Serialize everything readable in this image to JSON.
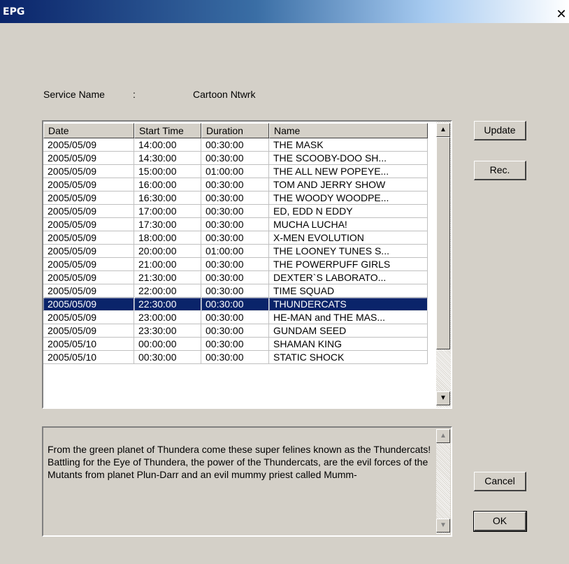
{
  "window": {
    "title": "EPG",
    "close_glyph": "✕"
  },
  "service": {
    "label": "Service Name",
    "sep": ":",
    "value": "Cartoon Ntwrk"
  },
  "table": {
    "columns": [
      "Date",
      "Start Time",
      "Duration",
      "Name"
    ],
    "rows": [
      [
        "2005/05/09",
        "14:00:00",
        "00:30:00",
        "THE MASK"
      ],
      [
        "2005/05/09",
        "14:30:00",
        "00:30:00",
        "THE SCOOBY-DOO SH..."
      ],
      [
        "2005/05/09",
        "15:00:00",
        "01:00:00",
        "THE ALL NEW POPEYE..."
      ],
      [
        "2005/05/09",
        "16:00:00",
        "00:30:00",
        "TOM AND JERRY SHOW"
      ],
      [
        "2005/05/09",
        "16:30:00",
        "00:30:00",
        "THE WOODY WOODPE..."
      ],
      [
        "2005/05/09",
        "17:00:00",
        "00:30:00",
        "ED, EDD N EDDY"
      ],
      [
        "2005/05/09",
        "17:30:00",
        "00:30:00",
        "MUCHA LUCHA!"
      ],
      [
        "2005/05/09",
        "18:00:00",
        "00:30:00",
        "X-MEN EVOLUTION"
      ],
      [
        "2005/05/09",
        "20:00:00",
        "01:00:00",
        "THE LOONEY TUNES S..."
      ],
      [
        "2005/05/09",
        "21:00:00",
        "00:30:00",
        "THE POWERPUFF GIRLS"
      ],
      [
        "2005/05/09",
        "21:30:00",
        "00:30:00",
        "DEXTER`S LABORATO..."
      ],
      [
        "2005/05/09",
        "22:00:00",
        "00:30:00",
        "TIME SQUAD"
      ],
      [
        "2005/05/09",
        "22:30:00",
        "00:30:00",
        "THUNDERCATS"
      ],
      [
        "2005/05/09",
        "23:00:00",
        "00:30:00",
        "HE-MAN and THE MAS..."
      ],
      [
        "2005/05/09",
        "23:30:00",
        "00:30:00",
        "GUNDAM SEED"
      ],
      [
        "2005/05/10",
        "00:00:00",
        "00:30:00",
        "SHAMAN KING"
      ],
      [
        "2005/05/10",
        "00:30:00",
        "00:30:00",
        "STATIC SHOCK"
      ]
    ],
    "selected_index": 12
  },
  "buttons": {
    "update": "Update",
    "rec": "Rec.",
    "cancel": "Cancel",
    "ok": "OK"
  },
  "description": "From the green planet of Thundera come these super felines known as the Thundercats!  Battling for the Eye of Thundera, the power of the Thundercats, are the evil forces of the Mutants from planet Plun-Darr and an evil mummy priest called Mumm-",
  "icons": {
    "scroll_up": "▲",
    "scroll_down": "▼",
    "close": "close-icon"
  },
  "colors": {
    "selection": "#0a246a",
    "title_gradient_start": "#0a246a",
    "dialog_bg": "#d4d0c8"
  }
}
